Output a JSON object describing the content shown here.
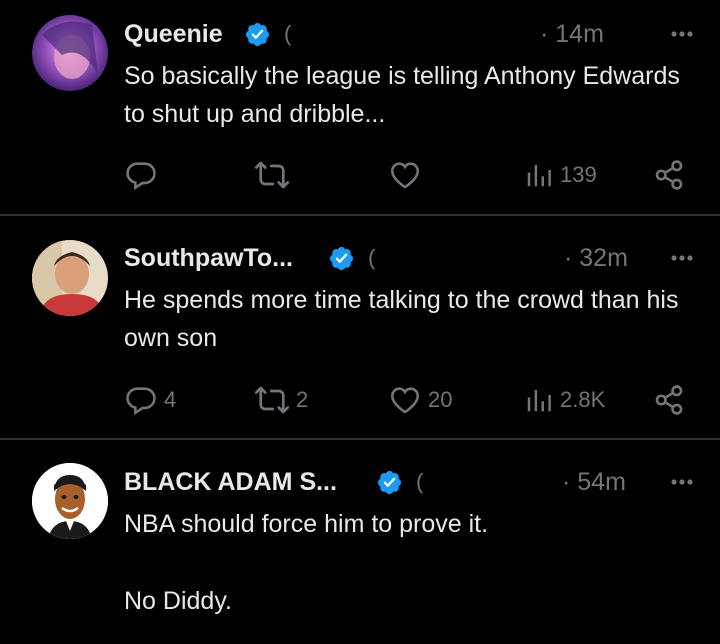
{
  "tweets": [
    {
      "name": "Queenie",
      "handle": "(",
      "time": "· 14m",
      "text": "So basically the league is telling Anthony Edwards to shut up and dribble...",
      "replies": "",
      "reposts": "",
      "likes": "",
      "views": "139"
    },
    {
      "name": "SouthpawTo...",
      "handle": "(",
      "time": "· 32m",
      "text": "He spends more time talking to the crowd than his own son",
      "replies": "4",
      "reposts": "2",
      "likes": "20",
      "views": "2.8K"
    },
    {
      "name": "BLACK ADAM S...",
      "handle": "(",
      "time": "· 54m",
      "text_line1": "NBA should force him to prove it.",
      "text_line2": "No Diddy."
    }
  ],
  "colors": {
    "background": "#000000",
    "text": "#e7e9ea",
    "muted": "#71767b",
    "verified": "#1d9bf0",
    "divider": "#2f3336"
  }
}
